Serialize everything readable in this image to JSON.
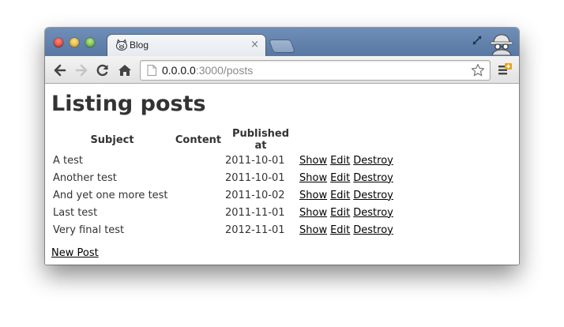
{
  "tab": {
    "title": "Blog",
    "close": "×"
  },
  "address": {
    "host": "0.0.0.0",
    "rest": ":3000/posts"
  },
  "page": {
    "title": "Listing posts",
    "columns": [
      "Subject",
      "Content",
      "Published at"
    ],
    "rows": [
      {
        "subject": "A test",
        "content": "",
        "published": "2011-10-01"
      },
      {
        "subject": "Another test",
        "content": "",
        "published": "2011-10-01"
      },
      {
        "subject": "And yet one more test",
        "content": "",
        "published": "2011-10-02"
      },
      {
        "subject": "Last test",
        "content": "",
        "published": "2011-11-01"
      },
      {
        "subject": "Very final test",
        "content": "",
        "published": "2012-11-01"
      }
    ],
    "actions": {
      "show": "Show",
      "edit": "Edit",
      "destroy": "Destroy"
    },
    "new_post": "New Post"
  },
  "icons": {
    "favicon": "pig-face-icon",
    "back": "back-arrow-icon",
    "forward": "forward-arrow-icon",
    "reload": "reload-icon",
    "home": "home-icon",
    "page": "page-icon",
    "star": "star-icon",
    "menu": "wrench-menu-icon",
    "fullscreen": "fullscreen-icon",
    "incognito": "incognito-icon"
  },
  "colors": {
    "titlebar": "#5878a3",
    "toolbar": "#e8e8e8",
    "link": "#000000"
  }
}
